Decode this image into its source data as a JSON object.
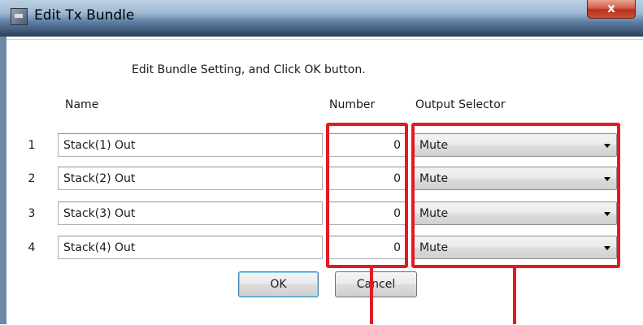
{
  "window": {
    "title": "Edit Tx Bundle",
    "close_label": "x",
    "icon": "window-app-icon"
  },
  "instruction": "Edit Bundle Setting, and Click OK button.",
  "headers": {
    "name": "Name",
    "number": "Number",
    "output": "Output Selector"
  },
  "rows": [
    {
      "index": "1",
      "name": "Stack(1) Out",
      "number": "0",
      "output": "Mute"
    },
    {
      "index": "2",
      "name": "Stack(2) Out",
      "number": "0",
      "output": "Mute"
    },
    {
      "index": "3",
      "name": "Stack(3) Out",
      "number": "0",
      "output": "Mute"
    },
    {
      "index": "4",
      "name": "Stack(4) Out",
      "number": "0",
      "output": "Mute"
    }
  ],
  "buttons": {
    "ok": "OK",
    "cancel": "Cancel"
  },
  "colors": {
    "highlight": "#e21a23",
    "titlebar": "#5e7fa4"
  }
}
